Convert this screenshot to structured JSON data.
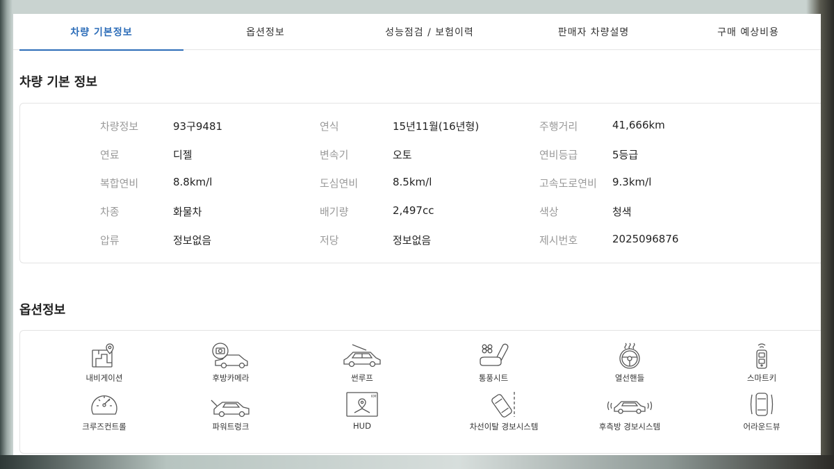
{
  "tabs": [
    {
      "label": "차량 기본정보",
      "active": true
    },
    {
      "label": "옵션정보",
      "active": false
    },
    {
      "label": "성능점검 / 보험이력",
      "active": false
    },
    {
      "label": "판매자 차량설명",
      "active": false
    },
    {
      "label": "구매 예상비용",
      "active": false
    }
  ],
  "basic_info": {
    "title": "차량 기본 정보",
    "rows": [
      [
        {
          "label": "차량정보",
          "value": "93구9481"
        },
        {
          "label": "연식",
          "value": "15년11월(16년형)"
        },
        {
          "label": "주행거리",
          "value": "41,666km"
        }
      ],
      [
        {
          "label": "연료",
          "value": "디젤"
        },
        {
          "label": "변속기",
          "value": "오토"
        },
        {
          "label": "연비등급",
          "value": "5등급"
        }
      ],
      [
        {
          "label": "복합연비",
          "value": "8.8km/l"
        },
        {
          "label": "도심연비",
          "value": "8.5km/l"
        },
        {
          "label": "고속도로연비",
          "value": "9.3km/l"
        }
      ],
      [
        {
          "label": "차종",
          "value": "화물차"
        },
        {
          "label": "배기량",
          "value": "2,497cc"
        },
        {
          "label": "색상",
          "value": "청색"
        }
      ],
      [
        {
          "label": "압류",
          "value": "정보없음"
        },
        {
          "label": "저당",
          "value": "정보없음"
        },
        {
          "label": "제시번호",
          "value": "2025096876"
        }
      ]
    ]
  },
  "options": {
    "title": "옵션정보",
    "items": [
      {
        "label": "내비게이션",
        "icon": "navigation-icon"
      },
      {
        "label": "후방카메라",
        "icon": "rear-camera-icon"
      },
      {
        "label": "썬루프",
        "icon": "sunroof-icon"
      },
      {
        "label": "통풍시트",
        "icon": "ventilated-seat-icon"
      },
      {
        "label": "열선핸들",
        "icon": "heated-steering-icon"
      },
      {
        "label": "스마트키",
        "icon": "smart-key-icon"
      },
      {
        "label": "크루즈컨트롤",
        "icon": "cruise-control-icon"
      },
      {
        "label": "파워트렁크",
        "icon": "power-trunk-icon"
      },
      {
        "label": "HUD",
        "icon": "hud-icon"
      },
      {
        "label": "차선이탈 경보시스템",
        "icon": "lane-departure-icon"
      },
      {
        "label": "후측방 경보시스템",
        "icon": "blind-spot-icon"
      },
      {
        "label": "어라운드뷰",
        "icon": "around-view-icon"
      }
    ]
  },
  "colors": {
    "accent": "#2b6cb8",
    "label_gray": "#9a9a9a",
    "text": "#222222"
  }
}
